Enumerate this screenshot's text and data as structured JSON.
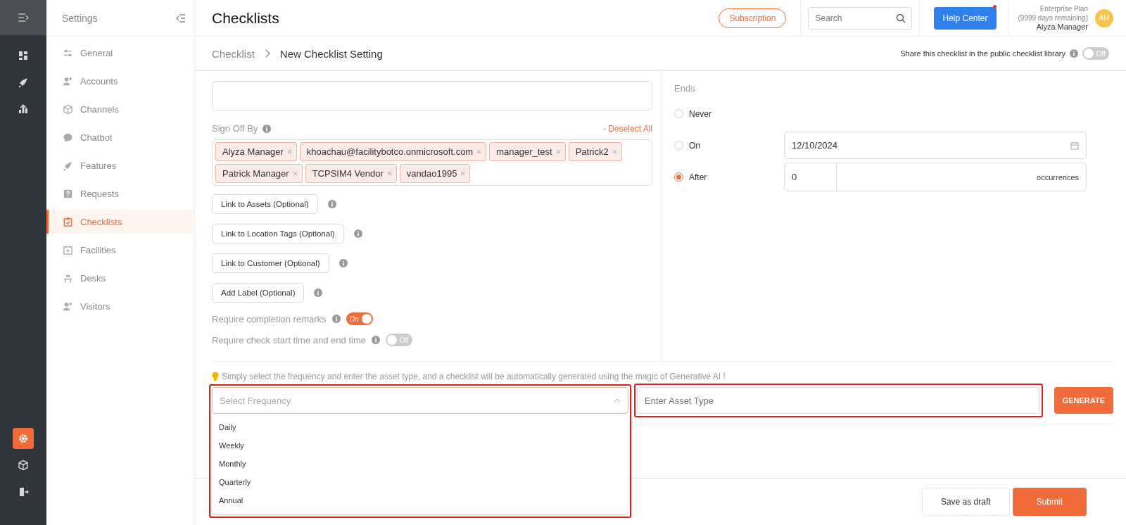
{
  "rail": {
    "top": [
      {
        "kind": "dashboard",
        "selected": false
      },
      {
        "kind": "rocket",
        "selected": false
      },
      {
        "kind": "chart",
        "selected": false
      }
    ],
    "bottom": [
      {
        "kind": "gear",
        "selected": true
      },
      {
        "kind": "box",
        "selected": false
      },
      {
        "kind": "exit",
        "selected": false
      }
    ]
  },
  "settings_panel": {
    "title": "Settings",
    "items": [
      {
        "label": "General",
        "selected": false
      },
      {
        "label": "Accounts",
        "selected": false
      },
      {
        "label": "Channels",
        "selected": false
      },
      {
        "label": "Chatbot",
        "selected": false
      },
      {
        "label": "Features",
        "selected": false
      },
      {
        "label": "Requests",
        "selected": false
      },
      {
        "label": "Checklists",
        "selected": true
      },
      {
        "label": "Facilities",
        "selected": false
      },
      {
        "label": "Desks",
        "selected": false
      },
      {
        "label": "Visitors",
        "selected": false
      }
    ]
  },
  "header": {
    "title": "Checklists",
    "subscription": "Subscription",
    "search": {
      "placeholder": "Search"
    },
    "help": "Help Center",
    "plan": "Enterprise Plan",
    "days": "(9999 days remaining)",
    "user": "Alyza Manager",
    "avatar": "AM"
  },
  "breadcrumb": [
    "Checklist",
    "New Checklist Setting"
  ],
  "share": {
    "label": "Share this checklist in the public checklist library",
    "on": false,
    "text": "Off"
  },
  "sign_off": {
    "label": "Sign Off By",
    "action": "- Deselect All",
    "tags": [
      "Alyza Manager",
      "khoachau@facilitybotco.onmicrosoft.com",
      "manager_test",
      "Patrick2",
      "Patrick Manager",
      "TCPSIM4 Vendor",
      "vandao1995"
    ]
  },
  "link_buttons": [
    "Link to Assets (Optional)",
    "Link to Location Tags (Optional)",
    "Link to Customer (Optional)",
    "Add Label (Optional)"
  ],
  "toggles": [
    {
      "label": "Require completion remarks",
      "on": true,
      "text": "On"
    },
    {
      "label": "Require check start time and end time",
      "on": false,
      "text": "Off"
    }
  ],
  "ends": {
    "title": "Ends",
    "options": [
      {
        "kind": "plain",
        "label": "Never",
        "selected": false
      },
      {
        "kind": "date",
        "label": "On",
        "selected": false,
        "value": "12/10/2024"
      },
      {
        "kind": "count",
        "label": "After",
        "selected": true,
        "value": "0",
        "unit": "occurrences"
      }
    ]
  },
  "ai": {
    "hint": "Simply select the frequency and enter the asset type, and a checklist will be automatically generated using the magic of Generative AI !",
    "frequency": {
      "placeholder": "Select Frequency",
      "expanded": true,
      "options": [
        "Daily",
        "Weekly",
        "Monthly",
        "Quarterly",
        "Annual"
      ]
    },
    "asset": {
      "placeholder": "Enter Asset Type"
    },
    "generate": "GENERATE"
  },
  "footer": {
    "buttons": [
      {
        "label": "Save as draft",
        "kind": "secondary"
      },
      {
        "label": "Submit",
        "kind": "primary"
      }
    ]
  }
}
